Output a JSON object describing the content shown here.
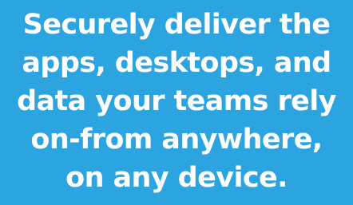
{
  "banner": {
    "background_color": "#2ba4e0",
    "text_color": "#ffffff",
    "headline_lines": [
      "Securely deliver the",
      "apps, desktops, and",
      "data your teams rely",
      "on-from anywhere,",
      "on any device."
    ]
  }
}
